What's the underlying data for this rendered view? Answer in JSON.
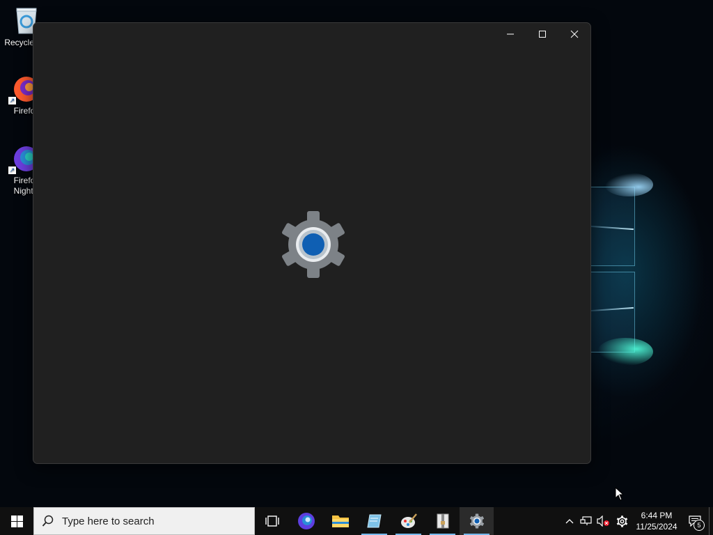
{
  "desktop": {
    "icons": [
      {
        "label": "Recycle Bin",
        "icon": "recycle-bin-icon"
      },
      {
        "label": "Firefox",
        "icon": "firefox-icon"
      },
      {
        "label": "Firefox Nightly",
        "icon": "firefox-nightly-icon"
      }
    ]
  },
  "window": {
    "app": "Settings",
    "splash_icon": "settings-gear-icon",
    "controls": [
      "minimize-icon",
      "maximize-icon",
      "close-icon"
    ]
  },
  "taskbar": {
    "search_placeholder": "Type here to search",
    "apps": [
      {
        "icon": "task-view-icon"
      },
      {
        "icon": "firefox-nightly-icon"
      },
      {
        "icon": "file-explorer-icon"
      },
      {
        "icon": "notepad-icon"
      },
      {
        "icon": "paint-icon"
      },
      {
        "icon": "archive-icon"
      },
      {
        "icon": "settings-gear-icon",
        "active": true
      }
    ],
    "tray": {
      "time": "6:44 PM",
      "date": "11/25/2024",
      "notification_count": "5"
    }
  },
  "colors": {
    "window_bg": "#202020",
    "taskbar_bg": "#101010",
    "accent": "#0f5fb3",
    "active_underline": "#76b9ed"
  }
}
